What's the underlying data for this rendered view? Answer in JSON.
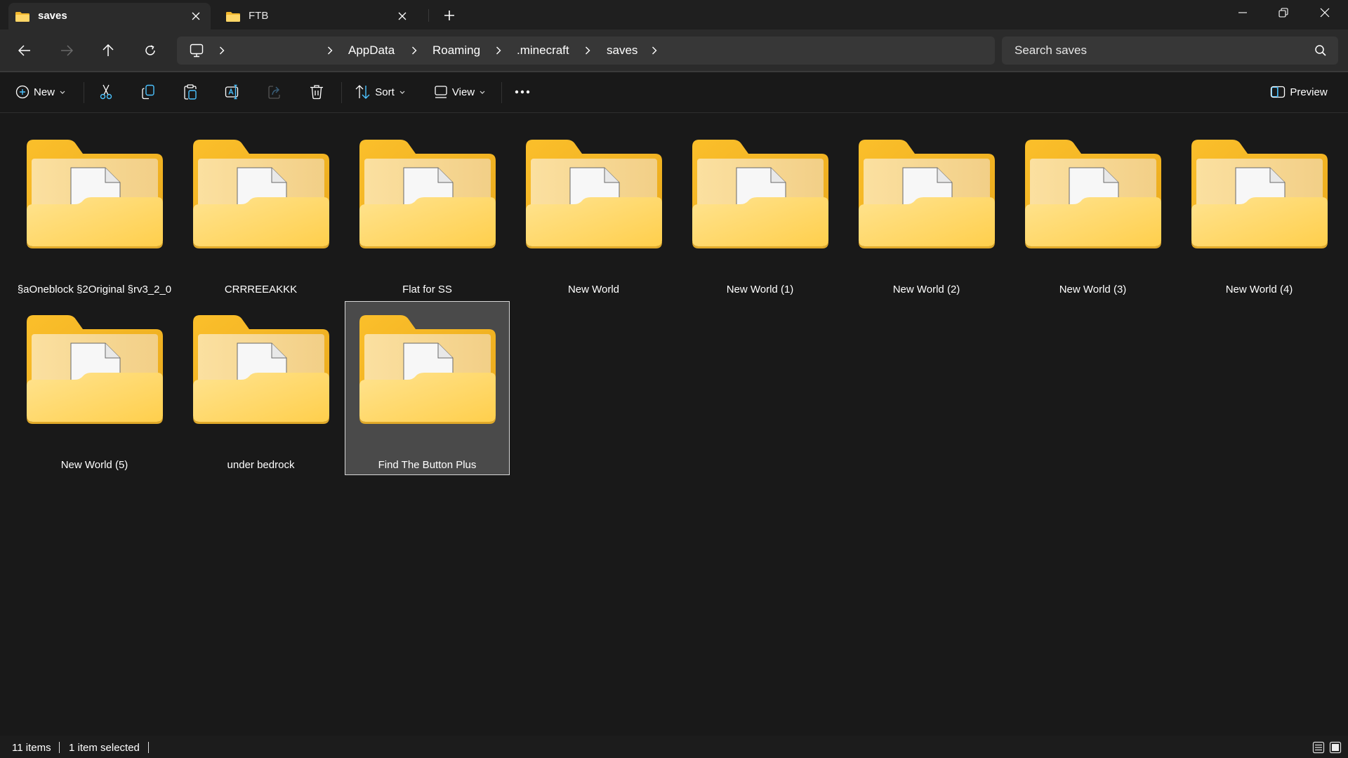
{
  "window": {
    "tabs": [
      {
        "label": "saves",
        "active": true,
        "icon": "folder-icon"
      },
      {
        "label": "FTB",
        "active": false,
        "icon": "folder-icon"
      }
    ],
    "new_tab_icon": "plus-icon",
    "controls": [
      "minimize-icon",
      "restore-icon",
      "close-icon"
    ]
  },
  "nav": {
    "back_icon": "arrow-left-icon",
    "forward_icon": "arrow-right-icon",
    "up_icon": "arrow-up-icon",
    "refresh_icon": "refresh-icon",
    "breadcrumb_root_icon": "this-pc-icon",
    "breadcrumbs": [
      "AppData",
      "Roaming",
      ".minecraft",
      "saves"
    ],
    "search_placeholder": "Search saves"
  },
  "toolbar": {
    "new_label": "New",
    "sort_label": "Sort",
    "view_label": "View",
    "preview_label": "Preview",
    "actions": [
      "cut-icon",
      "copy-icon",
      "paste-icon",
      "rename-icon",
      "share-icon",
      "delete-icon"
    ],
    "more_icon": "more-icon"
  },
  "items": [
    {
      "name": "§aOneblock §2Original §rv3_2_0",
      "type": "folder",
      "selected": false
    },
    {
      "name": "CRRREEAKKK",
      "type": "folder",
      "selected": false
    },
    {
      "name": "Flat for SS",
      "type": "folder",
      "selected": false
    },
    {
      "name": "New World",
      "type": "folder",
      "selected": false
    },
    {
      "name": "New World (1)",
      "type": "folder",
      "selected": false
    },
    {
      "name": "New World (2)",
      "type": "folder",
      "selected": false
    },
    {
      "name": "New World (3)",
      "type": "folder",
      "selected": false
    },
    {
      "name": "New World (4)",
      "type": "folder",
      "selected": false
    },
    {
      "name": "New World (5)",
      "type": "folder",
      "selected": false
    },
    {
      "name": "under bedrock",
      "type": "folder",
      "selected": false
    },
    {
      "name": "Find The Button Plus",
      "type": "folder",
      "selected": true
    }
  ],
  "status": {
    "item_count": "11 items",
    "selection": "1 item selected"
  },
  "colors": {
    "background": "#191919",
    "selection_bg": "#4a4a4a",
    "accent": "#4cc2ff",
    "folder": "#ffc83d"
  }
}
